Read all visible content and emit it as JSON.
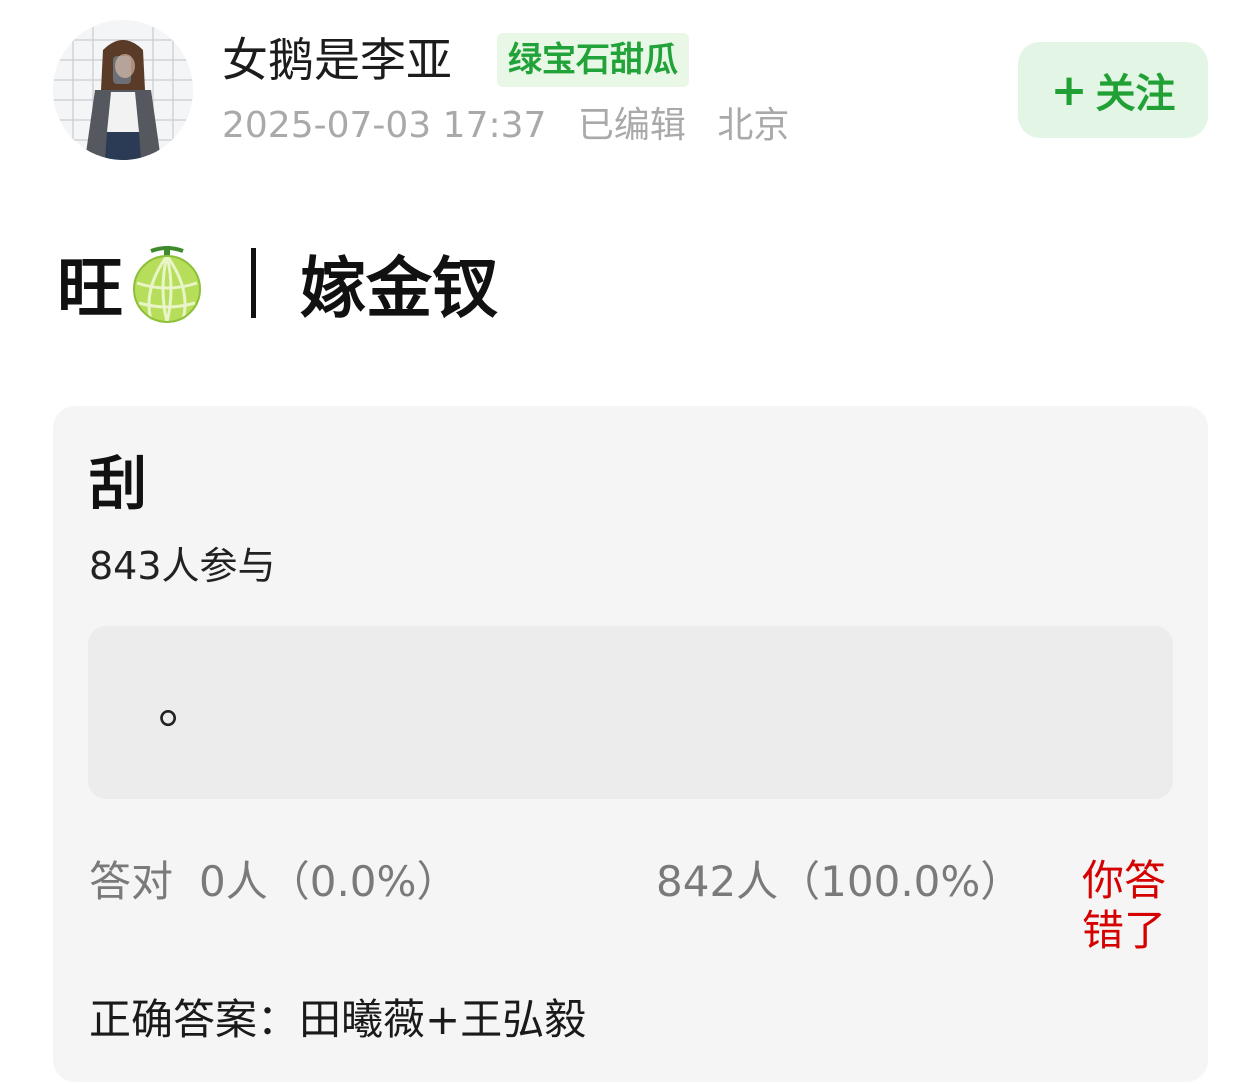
{
  "user": {
    "name": "女鹅是李亚",
    "badge": "绿宝石甜瓜",
    "timestamp": "2025-07-03 17:37",
    "edited": "已编辑",
    "location": "北京"
  },
  "follow": {
    "plus": "+",
    "label": "关注"
  },
  "post": {
    "title_prefix": "旺",
    "title_icon": "melon-emoji-icon",
    "title_suffix": "嫁金钗"
  },
  "quiz": {
    "question": "刮",
    "participants": "843人参与",
    "option_text": "。",
    "correct_label": "答对",
    "correct_value": "0人（0.0%）",
    "other_value": "842人（100.0%）",
    "result": "你答错了",
    "answer": "正确答案：田曦薇+王弘毅"
  },
  "colors": {
    "accent_green": "#21a135",
    "badge_bg": "#e9f7e6",
    "follow_bg": "#e3f6e5",
    "error_red": "#d50000",
    "card_bg": "#f5f5f5"
  }
}
